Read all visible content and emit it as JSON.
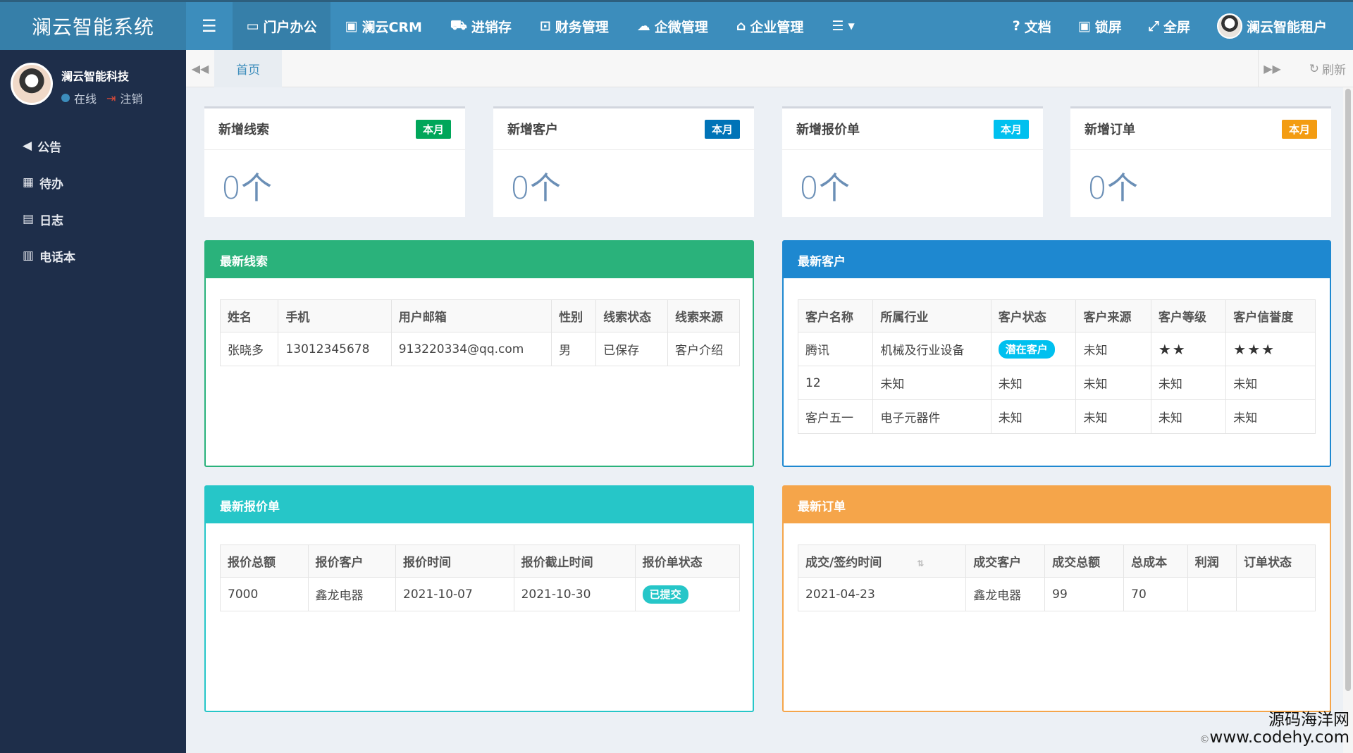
{
  "brand": "澜云智能系统",
  "topnav": [
    {
      "icon": "laptop-icon",
      "glyph": "▭",
      "label": "门户办公"
    },
    {
      "icon": "contact-book-icon",
      "glyph": "▣",
      "label": "澜云CRM"
    },
    {
      "icon": "shopping-bag-icon",
      "glyph": "⛟",
      "label": "进销存"
    },
    {
      "icon": "money-icon",
      "glyph": "⊡",
      "label": "财务管理"
    },
    {
      "icon": "cloud-icon",
      "glyph": "☁",
      "label": "企微管理"
    },
    {
      "icon": "bank-icon",
      "glyph": "⌂",
      "label": "企业管理"
    }
  ],
  "topright": [
    {
      "icon": "question-circle-icon",
      "glyph": "❓",
      "label": "文档"
    },
    {
      "icon": "lock-icon",
      "glyph": "🔒",
      "label": "锁屏"
    },
    {
      "icon": "fullscreen-icon",
      "glyph": "⤢",
      "label": "全屏"
    }
  ],
  "tenant_name": "澜云智能租户",
  "sidebar": {
    "user_name": "澜云智能科技",
    "status": "在线",
    "logout": "注销",
    "items": [
      {
        "icon": "bullhorn-icon",
        "glyph": "📢",
        "label": "公告"
      },
      {
        "icon": "calendar-icon",
        "glyph": "▦",
        "label": "待办"
      },
      {
        "icon": "file-text-icon",
        "glyph": "▤",
        "label": "日志"
      },
      {
        "icon": "address-book-icon",
        "glyph": "▥",
        "label": "电话本"
      }
    ]
  },
  "tabs": {
    "home": "首页",
    "refresh": "刷新"
  },
  "stats": [
    {
      "title": "新增线索",
      "badge": "本月",
      "value": "0个",
      "color": "#00a65a"
    },
    {
      "title": "新增客户",
      "badge": "本月",
      "value": "0个",
      "color": "#0073b7"
    },
    {
      "title": "新增报价单",
      "badge": "本月",
      "value": "0个",
      "color": "#00c0ef"
    },
    {
      "title": "新增订单",
      "badge": "本月",
      "value": "0个",
      "color": "#f39c12"
    }
  ],
  "leads": {
    "title": "最新线索",
    "color": "#2ab27b",
    "headers": [
      "姓名",
      "手机",
      "用户邮箱",
      "性别",
      "线索状态",
      "线索来源"
    ],
    "rows": [
      [
        "张晓多",
        "13012345678",
        "913220334@qq.com",
        "男",
        "已保存",
        "客户介绍"
      ]
    ]
  },
  "customers": {
    "title": "最新客户",
    "color": "#1e88d0",
    "headers": [
      "客户名称",
      "所属行业",
      "客户状态",
      "客户来源",
      "客户等级",
      "客户信誉度"
    ],
    "rows": [
      [
        "腾讯",
        "机械及行业设备",
        "潜在客户",
        "未知",
        "★★",
        "★★★"
      ],
      [
        "12",
        "未知",
        "未知",
        "未知",
        "未知",
        "未知"
      ],
      [
        "客户五一",
        "电子元器件",
        "未知",
        "未知",
        "未知",
        "未知"
      ]
    ]
  },
  "quotes": {
    "title": "最新报价单",
    "color": "#26c6c8",
    "headers": [
      "报价总额",
      "报价客户",
      "报价时间",
      "报价截止时间",
      "报价单状态"
    ],
    "rows": [
      [
        "7000",
        "鑫龙电器",
        "2021-10-07",
        "2021-10-30",
        "已提交"
      ]
    ]
  },
  "orders": {
    "title": "最新订单",
    "color": "#f5a54a",
    "headers": [
      "成交/签约时间",
      "成交客户",
      "成交总额",
      "总成本",
      "利润",
      "订单状态"
    ],
    "rows": [
      [
        "2021-04-23",
        "鑫龙电器",
        "99",
        "70",
        "",
        ""
      ]
    ]
  },
  "watermark": {
    "line1": "源码海洋网",
    "line2": "www.codehy.com",
    "copyright": "©"
  }
}
